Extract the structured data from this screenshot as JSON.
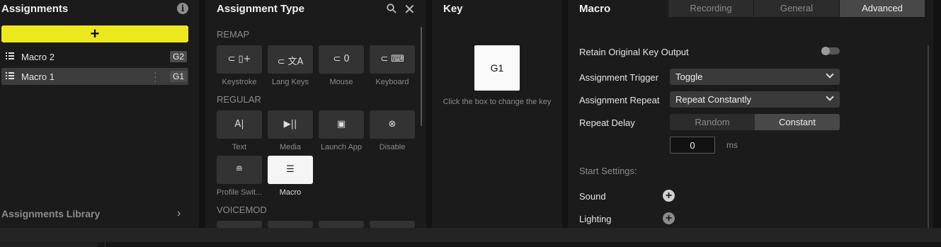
{
  "assignments": {
    "title": "Assignments",
    "items": [
      {
        "label": "Macro 2",
        "key": "G2"
      },
      {
        "label": "Macro 1",
        "key": "G1"
      }
    ],
    "library_label": "Assignments Library"
  },
  "assignment_type": {
    "title": "Assignment Type",
    "sections": {
      "remap": "REMAP",
      "regular": "REGULAR",
      "voicemod": "VOICEMOD"
    },
    "remap_tiles": [
      {
        "label": "Keystroke",
        "icon": "keystroke-icon"
      },
      {
        "label": "Lang Keys",
        "icon": "lang-keys-icon"
      },
      {
        "label": "Mouse",
        "icon": "mouse-icon"
      },
      {
        "label": "Keyboard",
        "icon": "keyboard-icon"
      }
    ],
    "regular_tiles": [
      {
        "label": "Text",
        "icon": "text-icon"
      },
      {
        "label": "Media",
        "icon": "media-icon"
      },
      {
        "label": "Launch App",
        "icon": "launch-app-icon"
      },
      {
        "label": "Disable",
        "icon": "disable-icon"
      },
      {
        "label": "Profile Swit...",
        "icon": "profile-switch-icon"
      },
      {
        "label": "Macro",
        "icon": "macro-icon"
      }
    ]
  },
  "key": {
    "title": "Key",
    "value": "G1",
    "hint": "Click the box to change the key"
  },
  "macro": {
    "title": "Macro",
    "tabs": [
      "Recording",
      "General",
      "Advanced"
    ],
    "active_tab": "Advanced",
    "retain_label": "Retain Original Key Output",
    "trigger_label": "Assignment Trigger",
    "trigger_value": "Toggle",
    "repeat_label": "Assignment Repeat",
    "repeat_value": "Repeat Constantly",
    "delay_label": "Repeat Delay",
    "delay_options": [
      "Random",
      "Constant"
    ],
    "delay_active": "Constant",
    "delay_value": "0",
    "delay_unit": "ms",
    "start_settings_label": "Start Settings:",
    "sound_label": "Sound",
    "lighting_label": "Lighting"
  },
  "colors": {
    "accent_yellow": "#ede81d",
    "panel_bg": "#1b1b1b",
    "tile_bg": "#333333"
  }
}
